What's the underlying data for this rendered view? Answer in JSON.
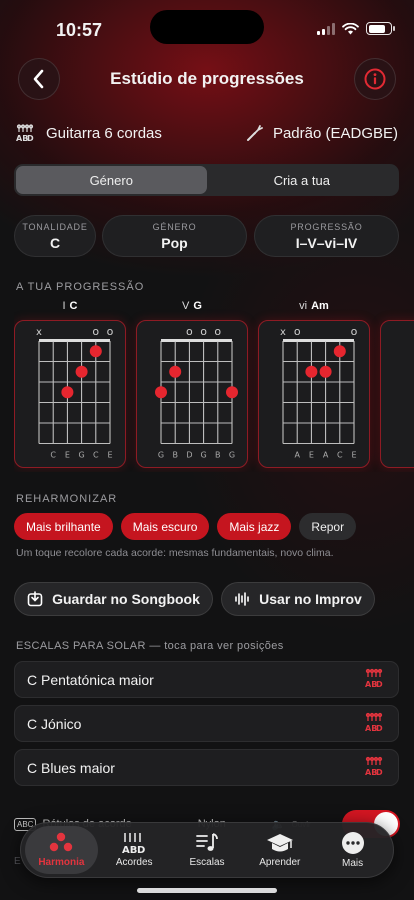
{
  "status_bar": {
    "time": "10:57"
  },
  "header": {
    "title": "Estúdio de progressões"
  },
  "instrument": {
    "name": "Guitarra 6 cordas",
    "tuning": "Padrão (EADGBE)"
  },
  "segmented": {
    "options": [
      "Género",
      "Cria a tua"
    ],
    "selected": "Género"
  },
  "pills": [
    {
      "label": "TONALIDADE",
      "value": "C"
    },
    {
      "label": "GÉNERO",
      "value": "Pop"
    },
    {
      "label": "PROGRESSÃO",
      "value": "I–V–vi–IV"
    }
  ],
  "progression": {
    "section_label": "A TUA PROGRESSÃO",
    "chords": [
      {
        "degree": "I",
        "name": "C",
        "top": [
          "x",
          "",
          "",
          "",
          "o",
          "o"
        ],
        "strings": [
          "C",
          "E",
          "G",
          "C",
          "E"
        ],
        "dots": [
          [
            2,
            3
          ],
          [
            3,
            2
          ],
          [
            4,
            1
          ]
        ]
      },
      {
        "degree": "V",
        "name": "G",
        "top": [
          "",
          "",
          "o",
          "o",
          "o",
          ""
        ],
        "strings": [
          "G",
          "B",
          "D",
          "G",
          "B",
          "G"
        ],
        "dots": [
          [
            0,
            3
          ],
          [
            1,
            2
          ],
          [
            5,
            3
          ]
        ]
      },
      {
        "degree": "vi",
        "name": "Am",
        "top": [
          "x",
          "o",
          "",
          "",
          "",
          "o"
        ],
        "strings": [
          "A",
          "E",
          "A",
          "C",
          "E"
        ],
        "dots": [
          [
            2,
            2
          ],
          [
            3,
            2
          ],
          [
            4,
            1
          ]
        ]
      }
    ]
  },
  "reharmonize": {
    "section_label": "REHARMONIZAR",
    "chips": [
      "Mais brilhante",
      "Mais escuro",
      "Mais jazz",
      "Repor"
    ],
    "hint": "Um toque recolore cada acorde: mesmas fundamentais, novo clima."
  },
  "actions": {
    "save": "Guardar no Songbook",
    "improv": "Usar no Improv"
  },
  "scales": {
    "section_label": "ESCALAS PARA SOLAR — toca para ver posições",
    "items": [
      "C Pentatónica maior",
      "C Jónico",
      "C Blues maior"
    ]
  },
  "toggles": {
    "chord_labels": "Rótulos de acorde",
    "tone": "Nylon",
    "listen": "Ouvir"
  },
  "tabbar": {
    "tabs": [
      "Harmonia",
      "Acordes",
      "Escalas",
      "Aprender",
      "Mais"
    ],
    "active": "Harmonia"
  },
  "colors": {
    "accent": "#d51622",
    "background": "#121213",
    "card_border": "#8e1b24"
  },
  "icons": [
    "back-chevron-icon",
    "info-icon",
    "guitar-tab-icon",
    "tuning-fork-icon",
    "download-icon",
    "waveform-icon",
    "tab-notation-icon",
    "speaker-icon",
    "music-notes-icon",
    "graduation-cap-icon",
    "ellipsis-icon"
  ]
}
